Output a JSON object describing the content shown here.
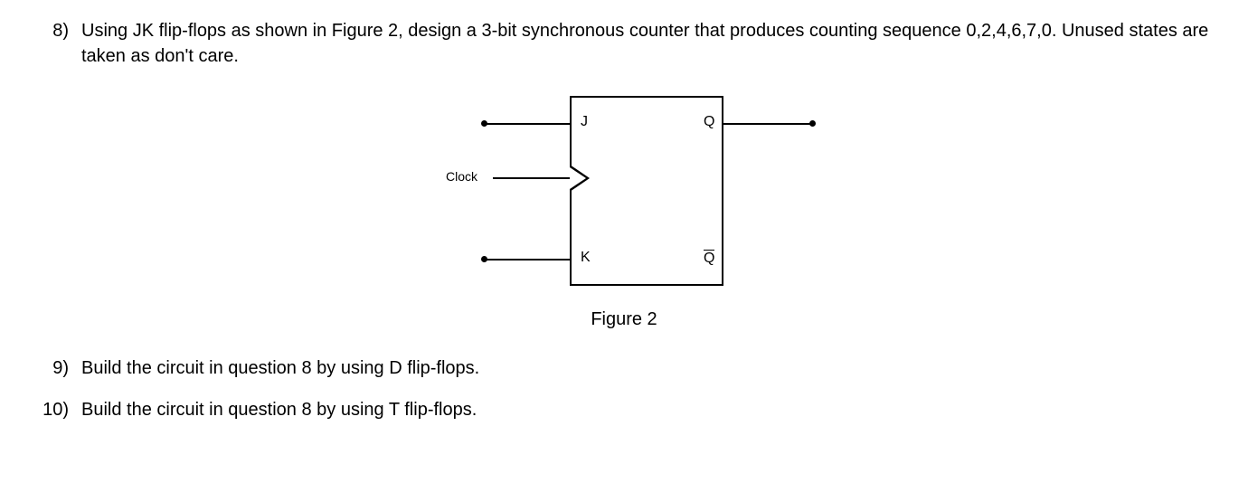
{
  "questions": {
    "q8": {
      "number": "8)",
      "text": "Using JK flip-flops as shown in Figure 2, design a 3-bit synchronous counter that produces counting sequence 0,2,4,6,7,0. Unused states are taken as don't care."
    },
    "q9": {
      "number": "9)",
      "text": "Build the circuit in question 8 by using D flip-flops."
    },
    "q10": {
      "number": "10)",
      "text": "Build the circuit in question 8 by using T flip-flops."
    }
  },
  "figure": {
    "caption": "Figure 2",
    "labels": {
      "j": "J",
      "k": "K",
      "q": "Q",
      "qbar": "Q",
      "clock": "Clock"
    }
  }
}
